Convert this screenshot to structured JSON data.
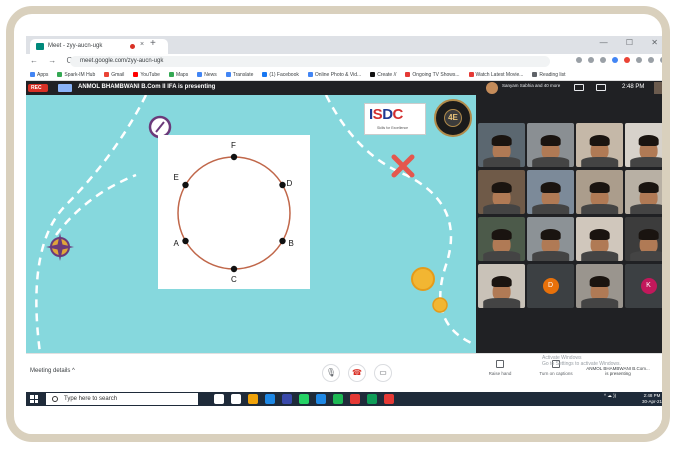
{
  "browser": {
    "tab_title": "Meet - zyy-aucn-ugk",
    "tab_close": "×",
    "new_tab": "+",
    "window_controls": "— ☐ ✕",
    "nav_buttons": "← → C",
    "url": "meet.google.com/zyy-aucn-ugk",
    "bookmarks": [
      {
        "label": "Apps",
        "color": "#4285f4"
      },
      {
        "label": "Spark-IM Hub",
        "color": "#34a853"
      },
      {
        "label": "Gmail",
        "color": "#ea4335"
      },
      {
        "label": "YouTube",
        "color": "#ff0000"
      },
      {
        "label": "Maps",
        "color": "#34a853"
      },
      {
        "label": "News",
        "color": "#4285f4"
      },
      {
        "label": "Translate",
        "color": "#4285f4"
      },
      {
        "label": "(1) Facebook",
        "color": "#1877f2"
      },
      {
        "label": "Online Photo & Vid...",
        "color": "#4285f4"
      },
      {
        "label": "Create //",
        "color": "#111111"
      },
      {
        "label": "Ongoing TV Shows...",
        "color": "#e53935"
      },
      {
        "label": "Watch Latest Movie...",
        "color": "#e53935"
      },
      {
        "label": "Reading list",
        "color": "#5f6368"
      }
    ]
  },
  "meet": {
    "rec_label": "REC",
    "presenter_text": "ANMOL BHAMBWANI B.Com II IFA is presenting",
    "participants_summary": "Sanyam Sabhia and 40 more",
    "clock": "2:48 PM",
    "meeting_details": "Meeting details",
    "meeting_details_chevron": "^",
    "controls": {
      "mic": "🎙",
      "hangup": "☎",
      "present": "▭"
    },
    "raise_hand": "Raise hand",
    "captions": "Turn on captions",
    "watermark": "Activate Windows\nGo to Settings to activate Windows.",
    "presenting_card": "ANMOL BHAMBWANI B.Com...\nis presenting",
    "more": "⋮",
    "tiles": [
      {
        "initial": "",
        "bg": "#5b6770"
      },
      {
        "initial": "",
        "bg": "#8a8f93"
      },
      {
        "initial": "",
        "bg": "#c5b8a8"
      },
      {
        "initial": "",
        "bg": "#d7d2cb"
      },
      {
        "initial": "",
        "bg": "#6f5a48"
      },
      {
        "initial": "",
        "bg": "#7c8a99"
      },
      {
        "initial": "",
        "bg": "#ab9d8c"
      },
      {
        "initial": "",
        "bg": "#b8b0a4"
      },
      {
        "initial": "",
        "bg": "#4c5a4a"
      },
      {
        "initial": "",
        "bg": "#8c9296"
      },
      {
        "initial": "",
        "bg": "#d0c7bc"
      },
      {
        "initial": "",
        "bg": "#3c3c3c"
      },
      {
        "initial": "",
        "bg": "#c9c2b8"
      },
      {
        "initial": "D",
        "bg": "#3c4043",
        "circle": "#e8710a"
      },
      {
        "initial": "",
        "bg": "#9a958e"
      },
      {
        "initial": "K",
        "bg": "#3c4043",
        "circle": "#c2185b"
      }
    ]
  },
  "slide": {
    "logo": {
      "i": "I",
      "s": "S",
      "d": "D",
      "c": "C",
      "tagline": "Skills for Excellence"
    },
    "seal_text": "4E",
    "points": [
      {
        "label": "F"
      },
      {
        "label": "D"
      },
      {
        "label": "B"
      },
      {
        "label": "C"
      },
      {
        "label": "A"
      },
      {
        "label": "E"
      }
    ]
  },
  "taskbar": {
    "search_placeholder": "Type here to search",
    "time": "2:48 PM",
    "date": "30-Apr-21",
    "tray": "^ ☁ ))",
    "icons": [
      "#ffffff",
      "#ffffff",
      "#f0a30a",
      "#1e88e5",
      "#3949ab",
      "#25d366",
      "#1e88e5",
      "#1db954",
      "#e53935",
      "#0f9d58",
      "#e53935"
    ]
  }
}
